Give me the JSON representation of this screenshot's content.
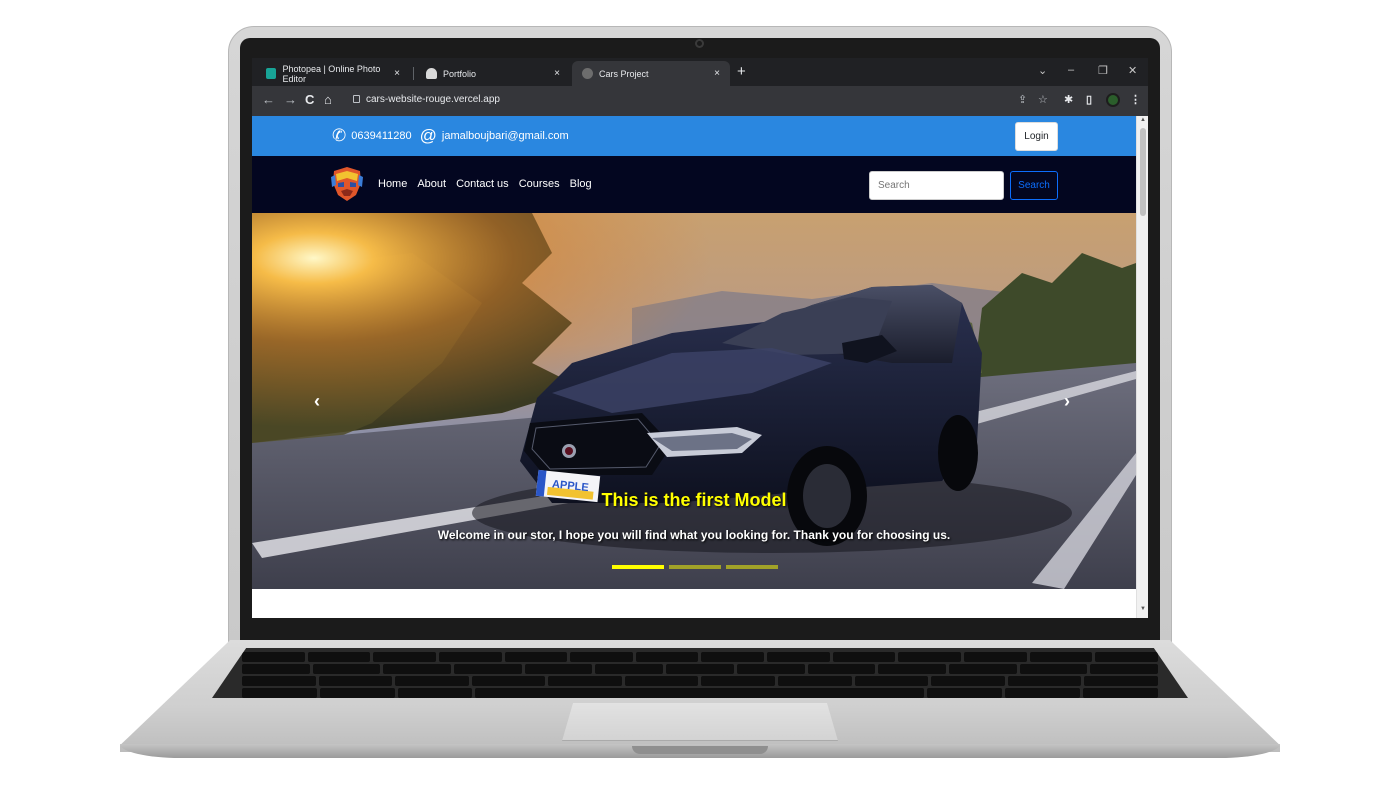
{
  "browser": {
    "tabs": [
      {
        "title": "Photopea | Online Photo Editor",
        "close": "×",
        "favicon_color": "#18a497"
      },
      {
        "title": "Portfolio",
        "close": "×",
        "favicon_color": "#d9d9d9"
      },
      {
        "title": "Cars Project",
        "close": "×",
        "favicon_color": "#6d6d6d"
      }
    ],
    "new_tab": "+",
    "window_controls": {
      "dropdown": "⌄",
      "minimize": "–",
      "restore": "❐",
      "close": "✕"
    },
    "nav": {
      "back": "←",
      "forward": "→",
      "reload": "C",
      "home": "⌂"
    },
    "url": "cars-website-rouge.vercel.app",
    "toolbar_icons": {
      "share": "⇪",
      "bookmark": "☆",
      "extensions": "✱",
      "sidepanel": "▯",
      "menu": "⋮"
    }
  },
  "site": {
    "topbar": {
      "phone_icon": "✆",
      "phone": "0639411280",
      "email_icon": "@",
      "email": "jamalboujbari@gmail.com",
      "login": "Login"
    },
    "nav": {
      "links": [
        "Home",
        "About",
        "Contact us",
        "Courses",
        "Blog"
      ],
      "search_placeholder": "Search",
      "search_button": "Search"
    },
    "carousel": {
      "title": "This is the first Model",
      "text": "Welcome in our stor, I hope you will find what you looking for. Thank you for choosing us.",
      "prev": "‹",
      "next": "›",
      "plate": "APPLE",
      "active_slide": 1,
      "slide_count": 3
    }
  },
  "colors": {
    "topbar": "#2a87e0",
    "navbar": "#030620",
    "accent_blue": "#0d6efd",
    "caption_yellow": "#ffff00"
  }
}
